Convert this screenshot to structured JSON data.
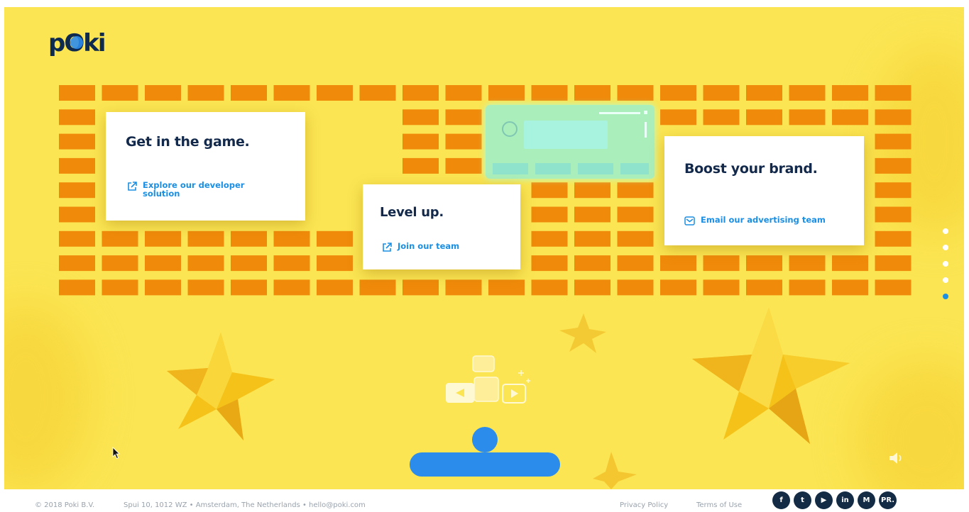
{
  "brand": {
    "logo_text": "pOki"
  },
  "cards": [
    {
      "title": "Get in the game.",
      "link": "Explore our developer solution"
    },
    {
      "title": "Level up.",
      "link": "Join our team"
    },
    {
      "title": "Boost your brand.",
      "link": "Email our advertising team"
    }
  ],
  "footer": {
    "copyright": "© 2018 Poki B.V.",
    "address": "Spui 10, 1012 WZ • Amsterdam, The Netherlands • hello@poki.com",
    "privacy": "Privacy Policy",
    "terms": "Terms of Use",
    "socials": [
      {
        "icon": "facebook-icon",
        "glyph": "f"
      },
      {
        "icon": "twitter-icon",
        "glyph": "t"
      },
      {
        "icon": "youtube-icon",
        "glyph": "▶"
      },
      {
        "icon": "linkedin-icon",
        "glyph": "in"
      },
      {
        "icon": "medium-icon",
        "glyph": "M"
      },
      {
        "icon": "press-icon",
        "glyph": "PR."
      }
    ]
  },
  "pager": {
    "count": 5,
    "active_index": 4
  },
  "colors": {
    "background": "#fbe552",
    "brick": "#f08a0a",
    "accent_blue": "#2b8cec",
    "link_blue": "#1a8fe3",
    "title_navy": "#13294b",
    "social_dark": "#132b44"
  }
}
